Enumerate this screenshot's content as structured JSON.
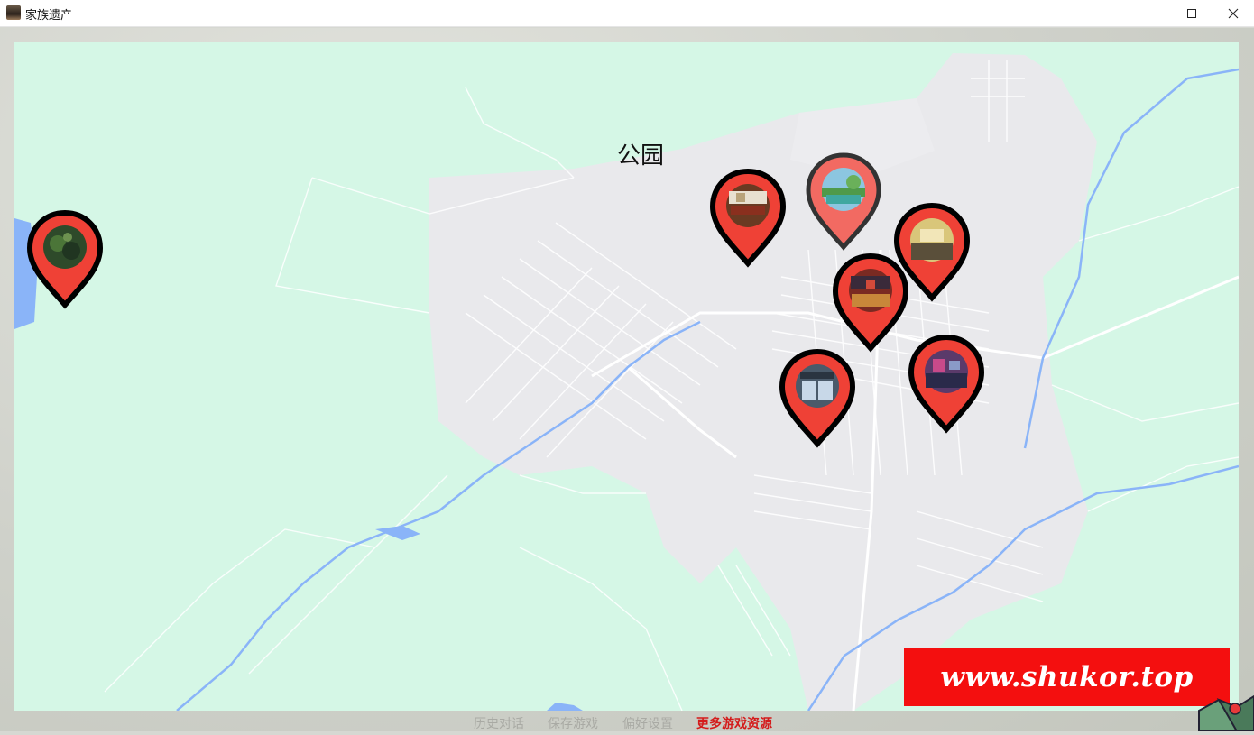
{
  "window": {
    "title": "家族遗产"
  },
  "map": {
    "location_title": "公园",
    "pins": [
      {
        "name": "pin-forest",
        "thumb": "forest"
      },
      {
        "name": "pin-office",
        "thumb": "office"
      },
      {
        "name": "pin-park",
        "thumb": "park",
        "hovered": true
      },
      {
        "name": "pin-lobby",
        "thumb": "lobby"
      },
      {
        "name": "pin-library",
        "thumb": "library"
      },
      {
        "name": "pin-storefront",
        "thumb": "storefront"
      },
      {
        "name": "pin-plaza",
        "thumb": "plaza"
      }
    ]
  },
  "quickmenu": {
    "history": "历史对话",
    "save": "保存游戏",
    "prefs": "偏好设置",
    "more": "更多游戏资源"
  },
  "watermark": {
    "text": "www.shukor.top"
  },
  "colors": {
    "pin": "#ef4136",
    "pin_hover": "#f26a62",
    "land": "#d5f7e6",
    "urban": "#e9e9ec",
    "water": "#8ab4f8"
  }
}
